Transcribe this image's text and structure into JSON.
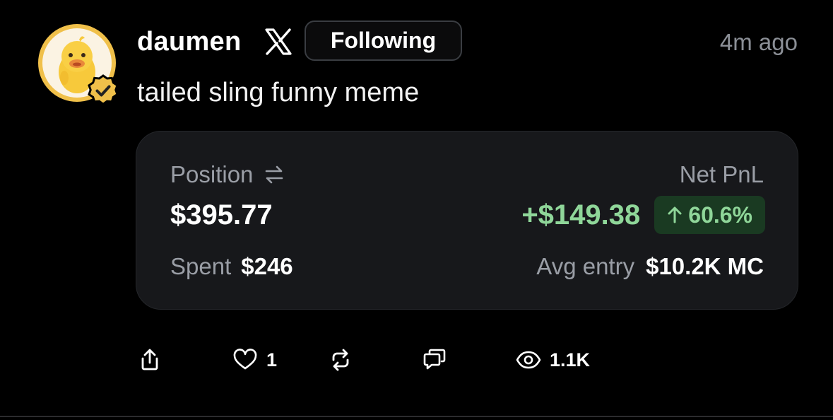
{
  "post": {
    "author": "daumen",
    "follow_label": "Following",
    "time": "4m ago",
    "message": "tailed sling funny meme"
  },
  "card": {
    "position_label": "Position",
    "position_value": "$395.77",
    "spent_label": "Spent",
    "spent_value": "$246",
    "pnl_label": "Net PnL",
    "pnl_value": "+$149.38",
    "pnl_percent": "60.6%",
    "avg_label": "Avg entry",
    "avg_value": "$10.2K MC"
  },
  "actions": {
    "likes": "1",
    "views": "1.1K"
  },
  "icons": {
    "platform": "x-logo-icon",
    "verified": "verified-badge-icon",
    "swap": "swap-arrows-icon",
    "up": "arrow-up-icon",
    "share": "share-icon",
    "like": "heart-icon",
    "repost": "repost-icon",
    "reply": "reply-icon",
    "views": "eye-icon"
  },
  "colors": {
    "background": "#000000",
    "card": "#17181b",
    "positive": "#8fd699",
    "positive_badge_bg": "#1a3a22",
    "muted": "#9a9ea6",
    "avatar_ring": "#f0c04a"
  }
}
